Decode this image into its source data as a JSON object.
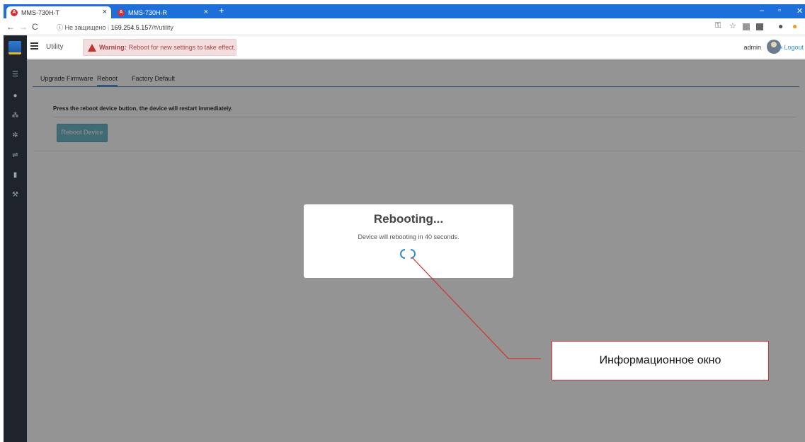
{
  "browser": {
    "tabs": [
      {
        "title": "MMS-730H-T",
        "active": true,
        "close": "×"
      },
      {
        "title": "MMS-730H-R",
        "active": false,
        "close": "×"
      }
    ],
    "new_tab": "+",
    "window_controls": {
      "minimize": "–",
      "restore": "▫",
      "close": "✕"
    },
    "security": "Не защищено",
    "url_host": "169.254.5.157",
    "url_path": "/#/utility",
    "icons": [
      "key-icon",
      "star-icon",
      "extension-icon",
      "extension-icon",
      "profile-icon",
      "menu-icon"
    ]
  },
  "app": {
    "sidebar_icons": [
      "list-icon",
      "user-icon",
      "network-icon",
      "gear-icon",
      "usb-icon",
      "device-icon",
      "wrench-icon"
    ],
    "breadcrumb": "Utility",
    "warning": {
      "label": "Warning:",
      "text": "Reboot for new settings to take effect."
    },
    "user": {
      "name": "admin",
      "logout": "Logout"
    }
  },
  "page": {
    "tabs": [
      {
        "label": "Upgrade Firmware",
        "selected": false
      },
      {
        "label": "Reboot",
        "selected": true
      },
      {
        "label": "Factory Default",
        "selected": false
      }
    ],
    "instruction": "Press the reboot device button, the device will restart immediately.",
    "reboot_button": "Reboot Device"
  },
  "modal": {
    "title": "Rebooting...",
    "message": "Device will rebooting in 40 seconds."
  },
  "annotation": {
    "label": "Информационное окно",
    "color": "#d23131"
  }
}
